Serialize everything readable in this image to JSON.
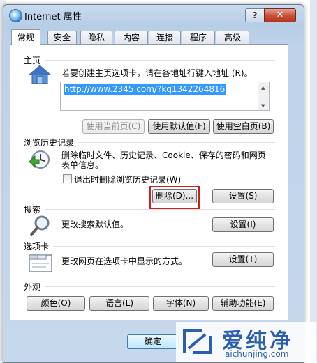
{
  "window": {
    "title": "Internet 属性",
    "help": "?",
    "close": "✕"
  },
  "tabs": [
    "常规",
    "安全",
    "隐私",
    "内容",
    "连接",
    "程序",
    "高级"
  ],
  "home": {
    "label": "主页",
    "desc": "若要创建主页选项卡，请在各地址行键入地址 (R)。",
    "url": "http://www.2345.com/?kq1342264816",
    "buttons": {
      "use_current": "使用当前页(C)",
      "use_default": "使用默认值(F)",
      "use_blank": "使用空白页(B)"
    }
  },
  "history": {
    "label": "浏览历史记录",
    "desc_line1": "删除临时文件、历史记录、Cookie、保存的密码和网页",
    "desc_line2": "表单信息。",
    "checkbox_label": "退出时删除浏览历史记录(W)",
    "delete": "删除(D)...",
    "settings": "设置(S)"
  },
  "search": {
    "label": "搜索",
    "desc": "更改搜索默认值。",
    "settings": "设置(I)"
  },
  "tabs_section": {
    "label": "选项卡",
    "desc": "更改网页在选项卡中显示的方式。",
    "settings": "设置(T)"
  },
  "appearance": {
    "label": "外观",
    "colors": "颜色(O)",
    "languages": "语言(L)",
    "fonts": "字体(N)",
    "accessibility": "辅助功能(E)"
  },
  "footer": {
    "ok": "确定"
  },
  "watermark": {
    "brand": "爱纯净",
    "url": "aichunjing.com"
  }
}
